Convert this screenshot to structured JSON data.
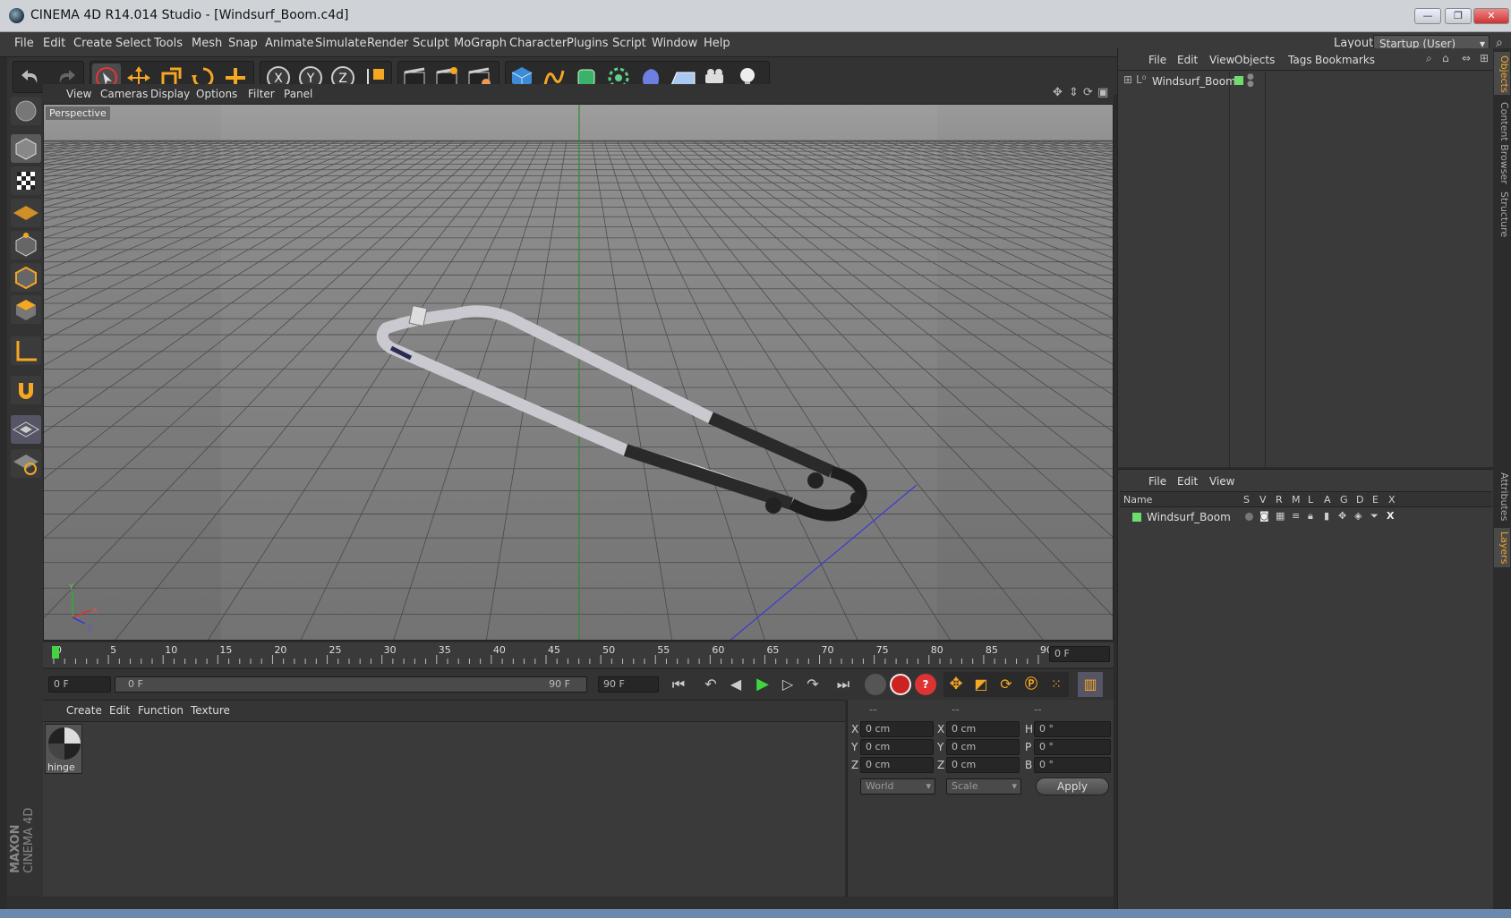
{
  "window": {
    "title": "CINEMA 4D R14.014 Studio - [Windsurf_Boom.c4d]",
    "buttons": [
      "minimize-icon",
      "restore-icon",
      "close-icon"
    ]
  },
  "menubar": {
    "items": [
      "File",
      "Edit",
      "Create",
      "Select",
      "Tools",
      "Mesh",
      "Snap",
      "Animate",
      "Simulate",
      "Render",
      "Sculpt",
      "MoGraph",
      "Character",
      "Plugins",
      "Script",
      "Window",
      "Help"
    ],
    "layout_label": "Layout:",
    "layout_value": "Startup (User)"
  },
  "toolbar": {
    "icons": [
      "undo-icon",
      "redo-icon",
      "live-selection-icon",
      "move-icon",
      "scale-icon",
      "rotate-icon",
      "add-icon",
      "x-axis-icon",
      "y-axis-icon",
      "z-axis-icon",
      "coordinate-system-icon",
      "render-view-icon",
      "render-picture-viewer-icon",
      "render-settings-icon",
      "cube-icon",
      "spline-icon",
      "subdivision-icon",
      "array-icon",
      "deformer-icon",
      "floor-icon",
      "camera-icon",
      "light-icon"
    ]
  },
  "lefttools": {
    "icons": [
      "make-editable-icon",
      "model-mode-icon",
      "texture-mode-icon",
      "workplane-icon",
      "points-mode-icon",
      "edges-mode-icon",
      "polygons-mode-icon",
      "axis-icon",
      "magnet-icon",
      "snap-icon",
      "lock-workplane-icon"
    ]
  },
  "viewport": {
    "menu": [
      "View",
      "Cameras",
      "Display",
      "Options",
      "Filter",
      "Panel"
    ],
    "label": "Perspective",
    "axes": {
      "x": "X",
      "y": "Y",
      "z": "Z"
    }
  },
  "timeline": {
    "ticks": [
      "0",
      "5",
      "10",
      "15",
      "20",
      "25",
      "30",
      "35",
      "40",
      "45",
      "50",
      "55",
      "60",
      "65",
      "70",
      "75",
      "80",
      "85",
      "90"
    ],
    "current_frame": "0 F",
    "start_field": "0 F",
    "range_start": "0 F",
    "range_end": "90 F",
    "end_field": "90 F"
  },
  "material_manager": {
    "menu": [
      "Create",
      "Edit",
      "Function",
      "Texture"
    ],
    "materials": [
      {
        "name": "hinge"
      }
    ]
  },
  "coordinates": {
    "headers": [
      "--",
      "--",
      "--"
    ],
    "rows": [
      {
        "a_label": "X",
        "a_value": "0 cm",
        "b_label": "X",
        "b_value": "0 cm",
        "c_label": "H",
        "c_value": "0 °"
      },
      {
        "a_label": "Y",
        "a_value": "0 cm",
        "b_label": "Y",
        "b_value": "0 cm",
        "c_label": "P",
        "c_value": "0 °"
      },
      {
        "a_label": "Z",
        "a_value": "0 cm",
        "b_label": "Z",
        "b_value": "0 cm",
        "c_label": "B",
        "c_value": "0 °"
      }
    ],
    "mode_select": "World",
    "scale_select": "Scale",
    "apply_label": "Apply"
  },
  "object_manager": {
    "menu": [
      "File",
      "Edit",
      "View",
      "Objects",
      "Tags",
      "Bookmarks"
    ],
    "objects": [
      {
        "name": "Windsurf_Boom"
      }
    ]
  },
  "layer_manager": {
    "menu": [
      "File",
      "Edit",
      "View"
    ],
    "columns": [
      "Name",
      "S",
      "V",
      "R",
      "M",
      "L",
      "A",
      "G",
      "D",
      "E",
      "X"
    ],
    "layers": [
      {
        "name": "Windsurf_Boom"
      }
    ]
  },
  "side_tabs": [
    "Objects",
    "Content Browser",
    "Structure",
    "Attributes",
    "Layers"
  ],
  "branding": {
    "line1": "MAXON",
    "line2": "CINEMA 4D"
  },
  "colors": {
    "accent": "#f5a623",
    "axis_green": "#2e8b2e",
    "axis_blue": "#3b3bd6",
    "layer_green": "#6fdc6f"
  }
}
